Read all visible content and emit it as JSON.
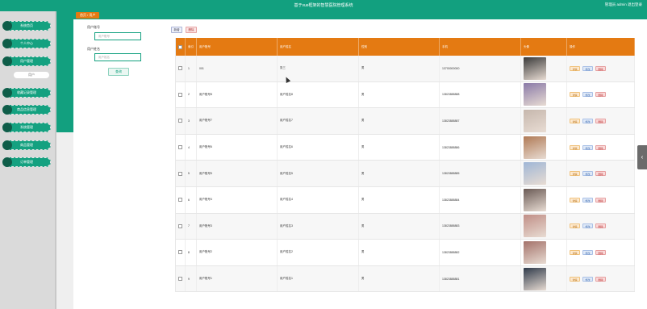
{
  "app": {
    "title": "基于vue框架的智慧医院管理系统",
    "user_text": "管理员 admin  退出登录"
  },
  "sidebar": {
    "items": [
      {
        "label": "系统首页"
      },
      {
        "label": "个人中心"
      },
      {
        "label": "用户管理"
      },
      {
        "label": "收藏记录管理"
      },
      {
        "label": "商品信息管理"
      },
      {
        "label": "系统管理"
      },
      {
        "label": "商品管理"
      },
      {
        "label": "订单管理"
      }
    ],
    "active_sub": "用户"
  },
  "breadcrumb": {
    "home": "首页",
    "separator": "/",
    "current": "用户"
  },
  "search": {
    "account_label": "用户账号",
    "account_placeholder": "用户账号",
    "name_label": "用户姓名",
    "name_placeholder": "用户姓名",
    "button_label": "查询"
  },
  "toolbar": {
    "add_label": "新增",
    "delete_label": "删除"
  },
  "table": {
    "headers": [
      "",
      "索引",
      "用户账号",
      "用户姓名",
      "性别",
      "手机",
      "头像",
      "操作"
    ],
    "actions": {
      "detail": "详情",
      "edit": "修改",
      "delete": "删除"
    },
    "rows": [
      {
        "index": "1",
        "account": "001",
        "name": "张三",
        "gender": "男",
        "phone": "13700000000",
        "avatar_color": "#3a3a3a"
      },
      {
        "index": "2",
        "account": "用户账号8",
        "name": "用户姓名8",
        "gender": "男",
        "phone": "13823888888",
        "avatar_color": "#8a7aa8"
      },
      {
        "index": "3",
        "account": "用户账号7",
        "name": "用户姓名7",
        "gender": "男",
        "phone": "13823888887",
        "avatar_color": "#c6b7ad"
      },
      {
        "index": "4",
        "account": "用户账号6",
        "name": "用户姓名6",
        "gender": "男",
        "phone": "13823888886",
        "avatar_color": "#b07a55"
      },
      {
        "index": "5",
        "account": "用户账号5",
        "name": "用户姓名5",
        "gender": "男",
        "phone": "13823888885",
        "avatar_color": "#9fb6d6"
      },
      {
        "index": "6",
        "account": "用户账号4",
        "name": "用户姓名4",
        "gender": "男",
        "phone": "13823888884",
        "avatar_color": "#6a5a55"
      },
      {
        "index": "7",
        "account": "用户账号3",
        "name": "用户姓名3",
        "gender": "男",
        "phone": "13823888883",
        "avatar_color": "#c08e86"
      },
      {
        "index": "8",
        "account": "用户账号2",
        "name": "用户姓名2",
        "gender": "男",
        "phone": "13823888882",
        "avatar_color": "#a4726a"
      },
      {
        "index": "9",
        "account": "用户账号1",
        "name": "用户姓名1",
        "gender": "男",
        "phone": "13823888881",
        "avatar_color": "#2f3a4a"
      }
    ]
  },
  "colors": {
    "primary": "#12a07f",
    "header": "#e47a12"
  }
}
